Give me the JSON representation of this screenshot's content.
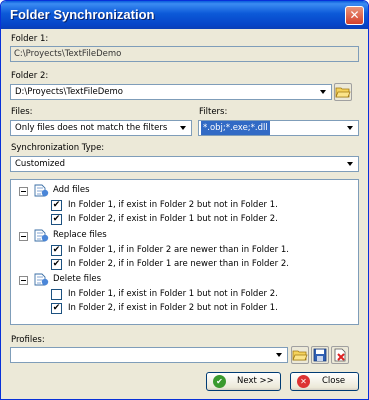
{
  "window": {
    "title": "Folder Synchronization"
  },
  "folder1": {
    "label": "Folder 1:",
    "value": "C:\\Proyects\\TextFileDemo"
  },
  "folder2": {
    "label": "Folder 2:",
    "value": "D:\\Proyects\\TextFileDemo"
  },
  "files": {
    "label": "Files:",
    "value": "Only files does not match the filters"
  },
  "filters": {
    "label": "Filters:",
    "value": "*.obj;*.exe;*.dll"
  },
  "sync_type": {
    "label": "Synchronization Type:",
    "value": "Customized"
  },
  "tree": {
    "groups": [
      {
        "label": "Add files",
        "items": [
          {
            "label": "In Folder 1, if exist in Folder 2 but not in Folder 1.",
            "checked": true
          },
          {
            "label": "In Folder 2, if exist in Folder 1 but not in Folder 2.",
            "checked": true
          }
        ]
      },
      {
        "label": "Replace files",
        "items": [
          {
            "label": "In Folder 1, if in Folder 2 are newer than in Folder 1.",
            "checked": true
          },
          {
            "label": "In Folder 2, if in Folder 1 are newer than in Folder 2.",
            "checked": true
          }
        ]
      },
      {
        "label": "Delete files",
        "items": [
          {
            "label": "In Folder 1, if exist in Folder 1 but not in Folder 2.",
            "checked": false
          },
          {
            "label": "In Folder 2, if exist in Folder 2 but not in Folder 1.",
            "checked": true
          }
        ]
      }
    ]
  },
  "profiles": {
    "label": "Profiles:",
    "value": ""
  },
  "buttons": {
    "next": "Next >>",
    "close": "Close"
  },
  "check_glyph": "✔",
  "icons": {
    "browse1": "folder-open-icon",
    "browse2": "folder-open-icon",
    "save": "save-disk-icon",
    "delete": "delete-profile-icon"
  }
}
